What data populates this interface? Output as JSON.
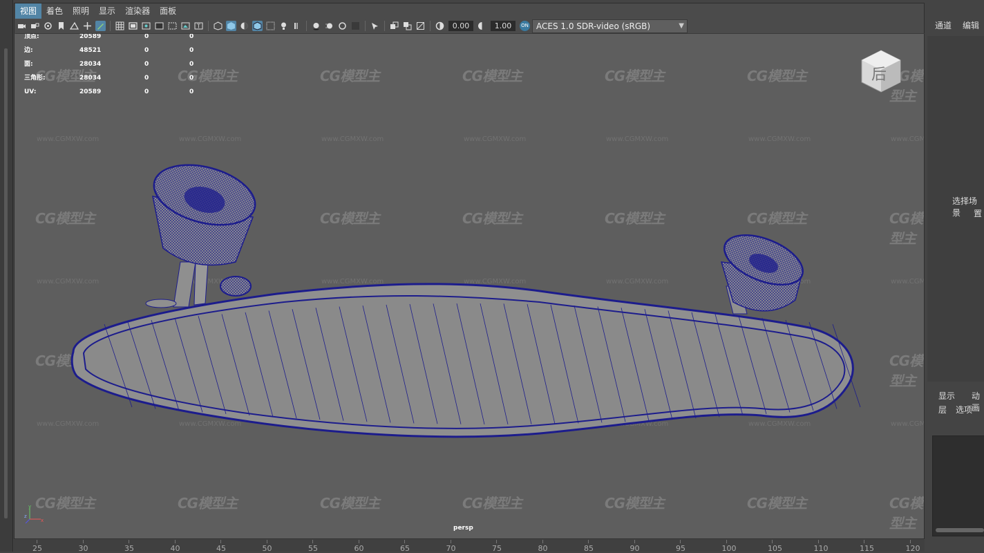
{
  "menu": [
    "视图",
    "着色",
    "照明",
    "显示",
    "渲染器",
    "面板"
  ],
  "toolbar": {
    "exposure": "0.00",
    "gamma": "1.00",
    "colorspace_badge": "ON",
    "colorspace": "ACES 1.0 SDR-video (sRGB)"
  },
  "hud": [
    {
      "label": "顶点:",
      "v1": "20589",
      "v2": "0",
      "v3": "0"
    },
    {
      "label": "边:",
      "v1": "48521",
      "v2": "0",
      "v3": "0"
    },
    {
      "label": "面:",
      "v1": "28034",
      "v2": "0",
      "v3": "0"
    },
    {
      "label": "三角形:",
      "v1": "28034",
      "v2": "0",
      "v3": "0"
    },
    {
      "label": "UV:",
      "v1": "20589",
      "v2": "0",
      "v3": "0"
    }
  ],
  "viewcube_label": "后",
  "camera_label": "persp",
  "axis": {
    "x": "x",
    "y": "y",
    "z": "z"
  },
  "watermark": {
    "logo": "CG模型主",
    "url": "www.CGMXW.com"
  },
  "right_panel": {
    "tab_channels": "通道",
    "tab_edit": "编辑",
    "message_line1": "选择场景",
    "message_line2": "置",
    "layer_tab_display": "显示",
    "layer_tab_anim": "动画",
    "layer_menu_layers": "层",
    "layer_menu_options": "选项"
  },
  "timeline_ticks": [
    "25",
    "30",
    "35",
    "40",
    "45",
    "50",
    "55",
    "60",
    "65",
    "70",
    "75",
    "80",
    "85",
    "90",
    "95",
    "100",
    "105",
    "110",
    "115",
    "120"
  ],
  "colors": {
    "wireframe": "#1c1c8c",
    "mesh_fill": "#8f8f8f",
    "viewport_bg": "#5e5e5e",
    "highlight": "#5285a6"
  }
}
